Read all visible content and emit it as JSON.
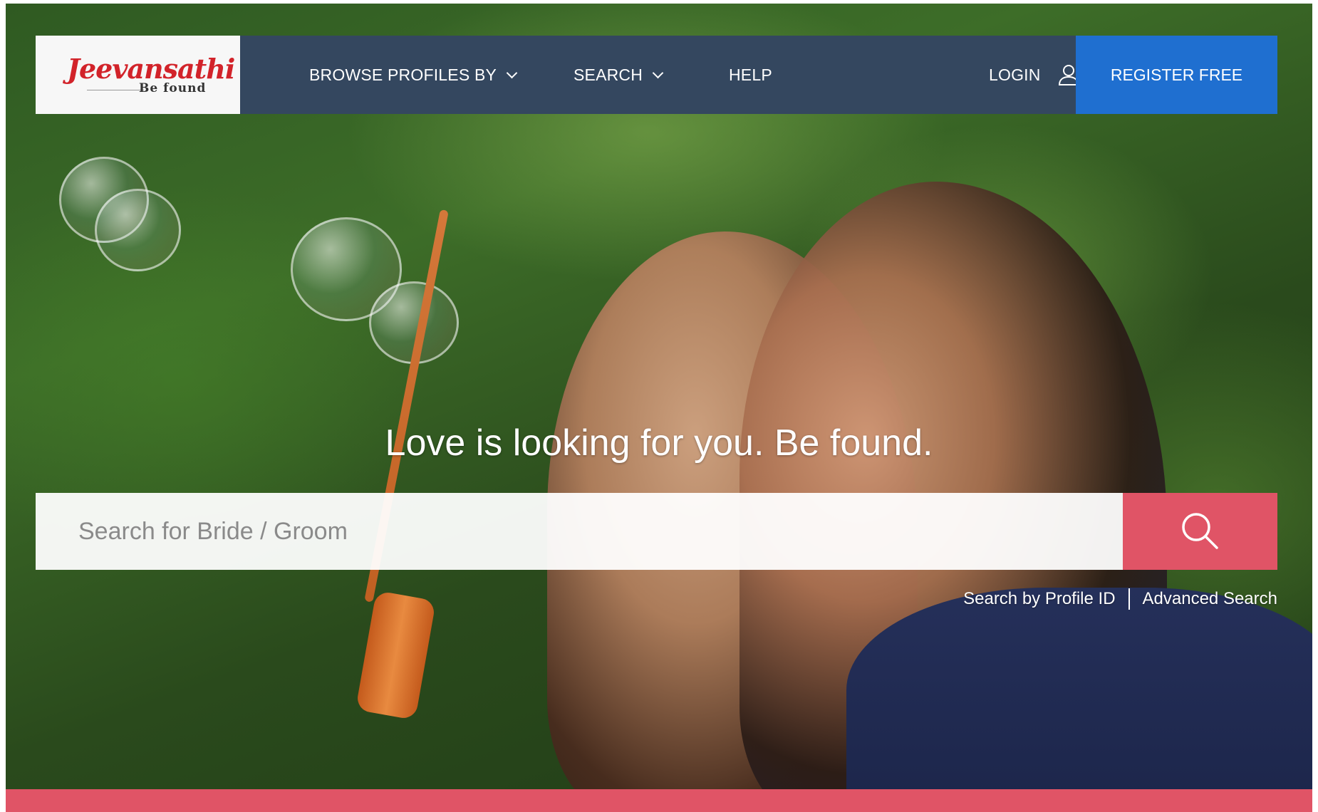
{
  "brand": {
    "name": "Jeevansathi",
    "tagline": "Be found",
    "color": "#d2232a"
  },
  "nav": {
    "items": [
      {
        "label": "BROWSE PROFILES BY",
        "has_dropdown": true
      },
      {
        "label": "SEARCH",
        "has_dropdown": true
      },
      {
        "label": "HELP",
        "has_dropdown": false
      }
    ],
    "login_label": "LOGIN",
    "register_label": "REGISTER FREE",
    "background_color": "#34475f",
    "register_color": "#1f6fd0"
  },
  "hero": {
    "headline": "Love is looking for you. Be found.",
    "search": {
      "placeholder": "Search for Bride / Groom",
      "value": "",
      "button_icon": "search-icon",
      "button_color": "#e05466"
    },
    "links": {
      "profile_id": "Search by Profile ID",
      "advanced": "Advanced Search"
    }
  },
  "footer_bar_color": "#e05466"
}
